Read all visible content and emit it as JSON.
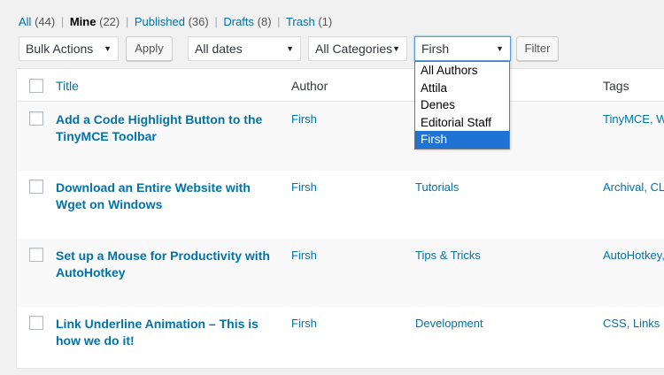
{
  "views": {
    "all": {
      "label": "All",
      "count": "(44)"
    },
    "mine": {
      "label": "Mine",
      "count": "(22)"
    },
    "published": {
      "label": "Published",
      "count": "(36)"
    },
    "drafts": {
      "label": "Drafts",
      "count": "(8)"
    },
    "trash": {
      "label": "Trash",
      "count": "(1)"
    },
    "separator": "|"
  },
  "filters": {
    "bulk_actions": "Bulk Actions",
    "apply": "Apply",
    "dates": "All dates",
    "categories": "All Categories",
    "author": "Firsh",
    "filter": "Filter"
  },
  "author_dropdown": {
    "options": [
      "All Authors",
      "Attila",
      "Denes",
      "Editorial Staff",
      "Firsh"
    ],
    "selected": "Firsh"
  },
  "table": {
    "headers": {
      "title": "Title",
      "author": "Author",
      "tags": "Tags"
    },
    "rows": [
      {
        "title": "Add a Code Highlight Button to the TinyMCE Toolbar",
        "author": "Firsh",
        "category": "",
        "tags": "TinyMCE, Wo"
      },
      {
        "title": "Download an Entire Website with Wget on Windows",
        "author": "Firsh",
        "category": "Tutorials",
        "tags": "Archival, CLI"
      },
      {
        "title": "Set up a Mouse for Productivity with AutoHotkey",
        "author": "Firsh",
        "category": "Tips & Tricks",
        "tags": "AutoHotkey,"
      },
      {
        "title": "Link Underline Animation – This is how we do it!",
        "author": "Firsh",
        "category": "Development",
        "tags": "CSS, Links"
      }
    ]
  },
  "colors": {
    "link": "#0073aa",
    "selected_option": "#1e73d4",
    "background": "#f1f1f1"
  },
  "icons": {
    "select_arrow": "▼"
  }
}
